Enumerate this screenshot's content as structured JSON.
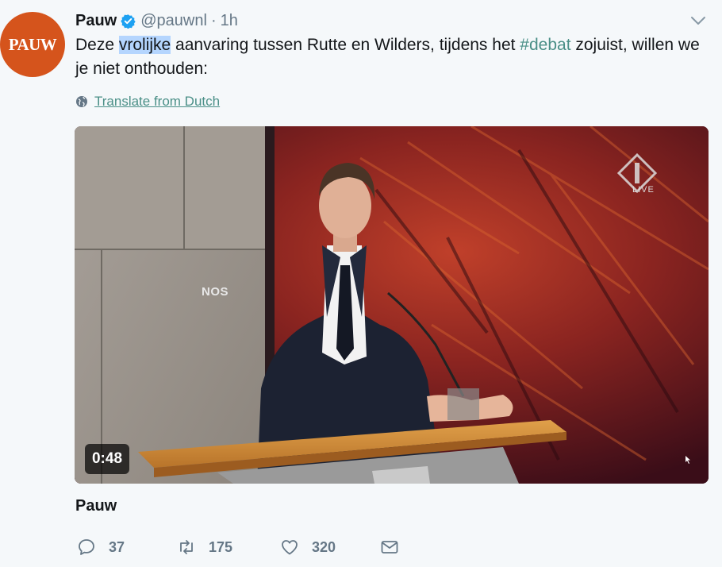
{
  "tweet": {
    "avatar_text": "PAUW",
    "author_name": "Pauw",
    "handle": "@pauwnl",
    "separator": "·",
    "time": "1h",
    "text_before": "Deze ",
    "text_highlight": "vrolijke",
    "text_middle": " aanvaring tussen Rutte en Wilders, tijdens het ",
    "hashtag": "#debat",
    "text_after": " zojuist, willen we je niet onthouden:",
    "translate_label": "Translate from Dutch"
  },
  "video": {
    "duration": "0:48",
    "watermark_left": "NOS",
    "watermark_right_label": "LIVE",
    "card_title": "Pauw"
  },
  "actions": {
    "reply_count": "37",
    "retweet_count": "175",
    "like_count": "320"
  },
  "colors": {
    "avatar_bg": "#d5541c",
    "link": "#4a8f87",
    "highlight": "#b4d5fe",
    "verified": "#1da1f2"
  },
  "icons": [
    "verified-badge-icon",
    "chevron-down-icon",
    "globe-icon",
    "reply-icon",
    "retweet-icon",
    "heart-icon",
    "envelope-icon"
  ]
}
